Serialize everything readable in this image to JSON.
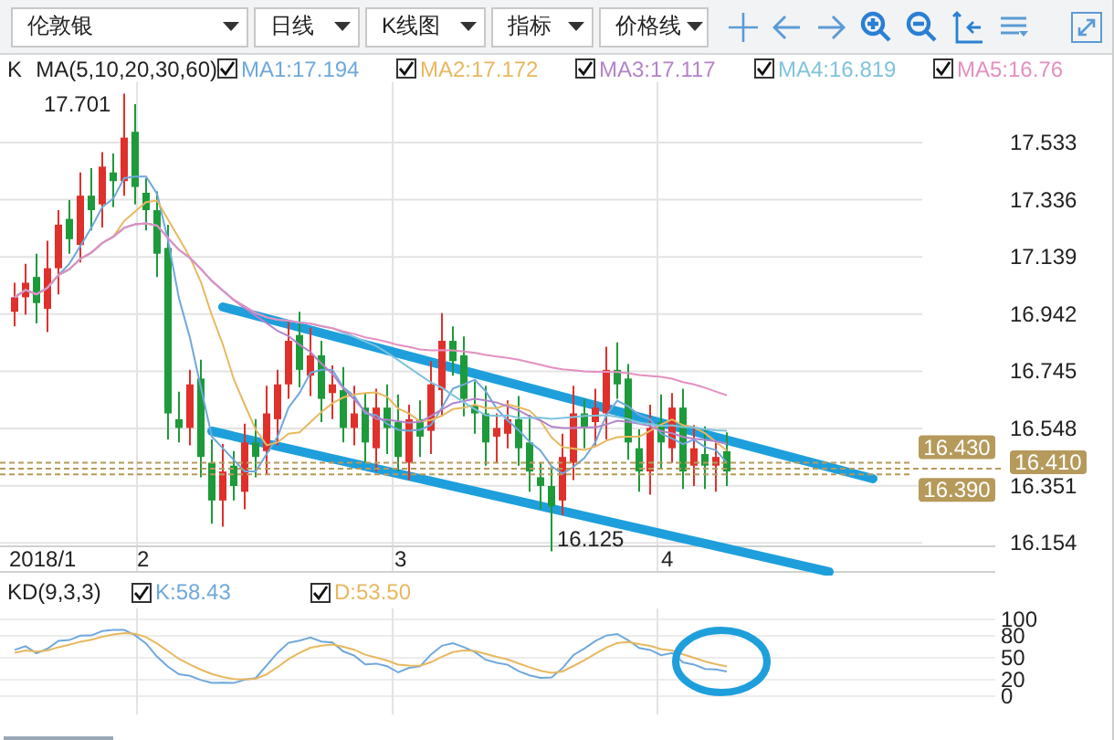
{
  "toolbar": {
    "dropdowns": [
      {
        "label": "伦敦银"
      },
      {
        "label": "日线"
      },
      {
        "label": "K线图"
      },
      {
        "label": "指标"
      },
      {
        "label": "价格线"
      }
    ]
  },
  "legend": {
    "label": "K",
    "params": "MA(5,10,20,30,60)",
    "items": [
      {
        "text": "MA1:17.194",
        "checked": true,
        "color": "#6fa8dc"
      },
      {
        "text": "MA2:17.172",
        "checked": true,
        "color": "#e8b860"
      },
      {
        "text": "MA3:17.117",
        "checked": true,
        "color": "#b384c9"
      },
      {
        "text": "MA4:16.819",
        "checked": true,
        "color": "#7fc3dd"
      },
      {
        "text": "MA5:16.76",
        "checked": true,
        "color": "#e48fc0"
      }
    ]
  },
  "price_axis": [
    "17.533",
    "17.336",
    "17.139",
    "16.942",
    "16.745",
    "16.548",
    "16.351",
    "16.154"
  ],
  "price_tags": [
    {
      "text": "16.430",
      "kind": "high"
    },
    {
      "text": "16.410",
      "kind": "last"
    },
    {
      "text": "16.390",
      "kind": "low"
    }
  ],
  "high_label": "17.701",
  "low_label": "16.125",
  "date_axis": [
    "2018/1",
    "2",
    "3",
    "4"
  ],
  "kd": {
    "label": "KD(9,3,3)",
    "items": [
      {
        "text": "K:58.43",
        "checked": true,
        "color": "#6fa8dc"
      },
      {
        "text": "D:53.50",
        "checked": true,
        "color": "#e8b860"
      }
    ],
    "ticks": [
      "100",
      "80",
      "50",
      "20",
      "0"
    ]
  }
}
